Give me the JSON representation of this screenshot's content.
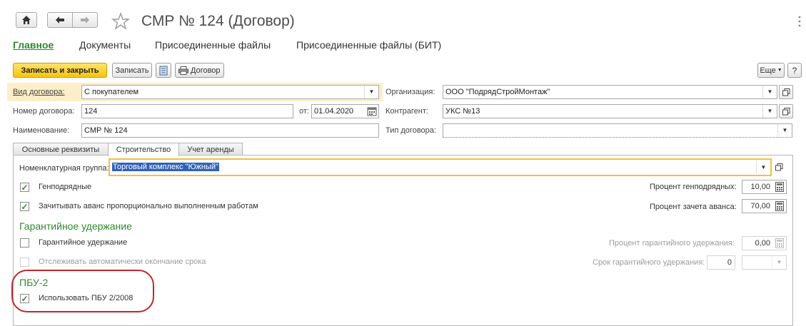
{
  "window": {
    "title": "СМР № 124 (Договор)",
    "home_icon": "home-icon",
    "back_icon": "arrow-left-icon",
    "forward_icon": "arrow-right-icon",
    "favorite_icon": "star-icon",
    "more_icon": "vertical-dots-icon"
  },
  "nav": {
    "main": "Главное",
    "documents": "Документы",
    "attached_files": "Присоединенные файлы",
    "attached_files_bit": "Присоединенные файлы (БИТ)"
  },
  "toolbar": {
    "save_close": "Записать и закрыть",
    "save": "Записать",
    "contract_print": "Договор",
    "more": "Еще",
    "help": "?"
  },
  "form": {
    "contract_type_label": "Вид договора:",
    "contract_type_value": "С покупателем",
    "number_label": "Номер договора:",
    "number_value": "124",
    "date_label": "от:",
    "date_value": "01.04.2020",
    "name_label": "Наименование:",
    "name_value": "СМР № 124",
    "org_label": "Организация:",
    "org_value": "ООО \"ПодрядСтройМонтаж\"",
    "counterparty_label": "Контрагент:",
    "counterparty_value": "УКС №13",
    "contract_kind_label": "Тип договора:",
    "contract_kind_value": ""
  },
  "tabs": [
    "Основные реквизиты",
    "Строительство",
    "Учет аренды"
  ],
  "construction": {
    "nomenclature_label": "Номенклатурная группа:",
    "nomenclature_value": "Торговый комплекс \"Южный\"",
    "general_contract_label": "Генподрядные",
    "general_contract_checked": true,
    "general_percent_label": "Процент генподрядных:",
    "general_percent_value": "10,00",
    "advance_offset_label": "Зачитывать аванс пропорционально выполненным работам",
    "advance_offset_checked": true,
    "advance_percent_label": "Процент зачета аванса:",
    "advance_percent_value": "70,00",
    "warranty_section": "Гарантийное удержание",
    "warranty_label": "Гарантийное удержание",
    "warranty_checked": false,
    "warranty_percent_label": "Процент гарантийного удержания:",
    "warranty_percent_value": "0,00",
    "track_end_label": "Отслеживать автоматически окончание срока",
    "track_end_checked": false,
    "warranty_term_label": "Срок гарантийного удержания:",
    "warranty_term_value": "0",
    "pbu_section": "ПБУ-2",
    "pbu_label": "Использовать ПБУ 2/2008",
    "pbu_checked": true
  },
  "colors": {
    "accent_green": "#2e8b2e",
    "primary_button": "#f5c50c",
    "highlight_border": "#f0c040",
    "selection": "#3162b8",
    "annotation_red": "#c0282d"
  }
}
